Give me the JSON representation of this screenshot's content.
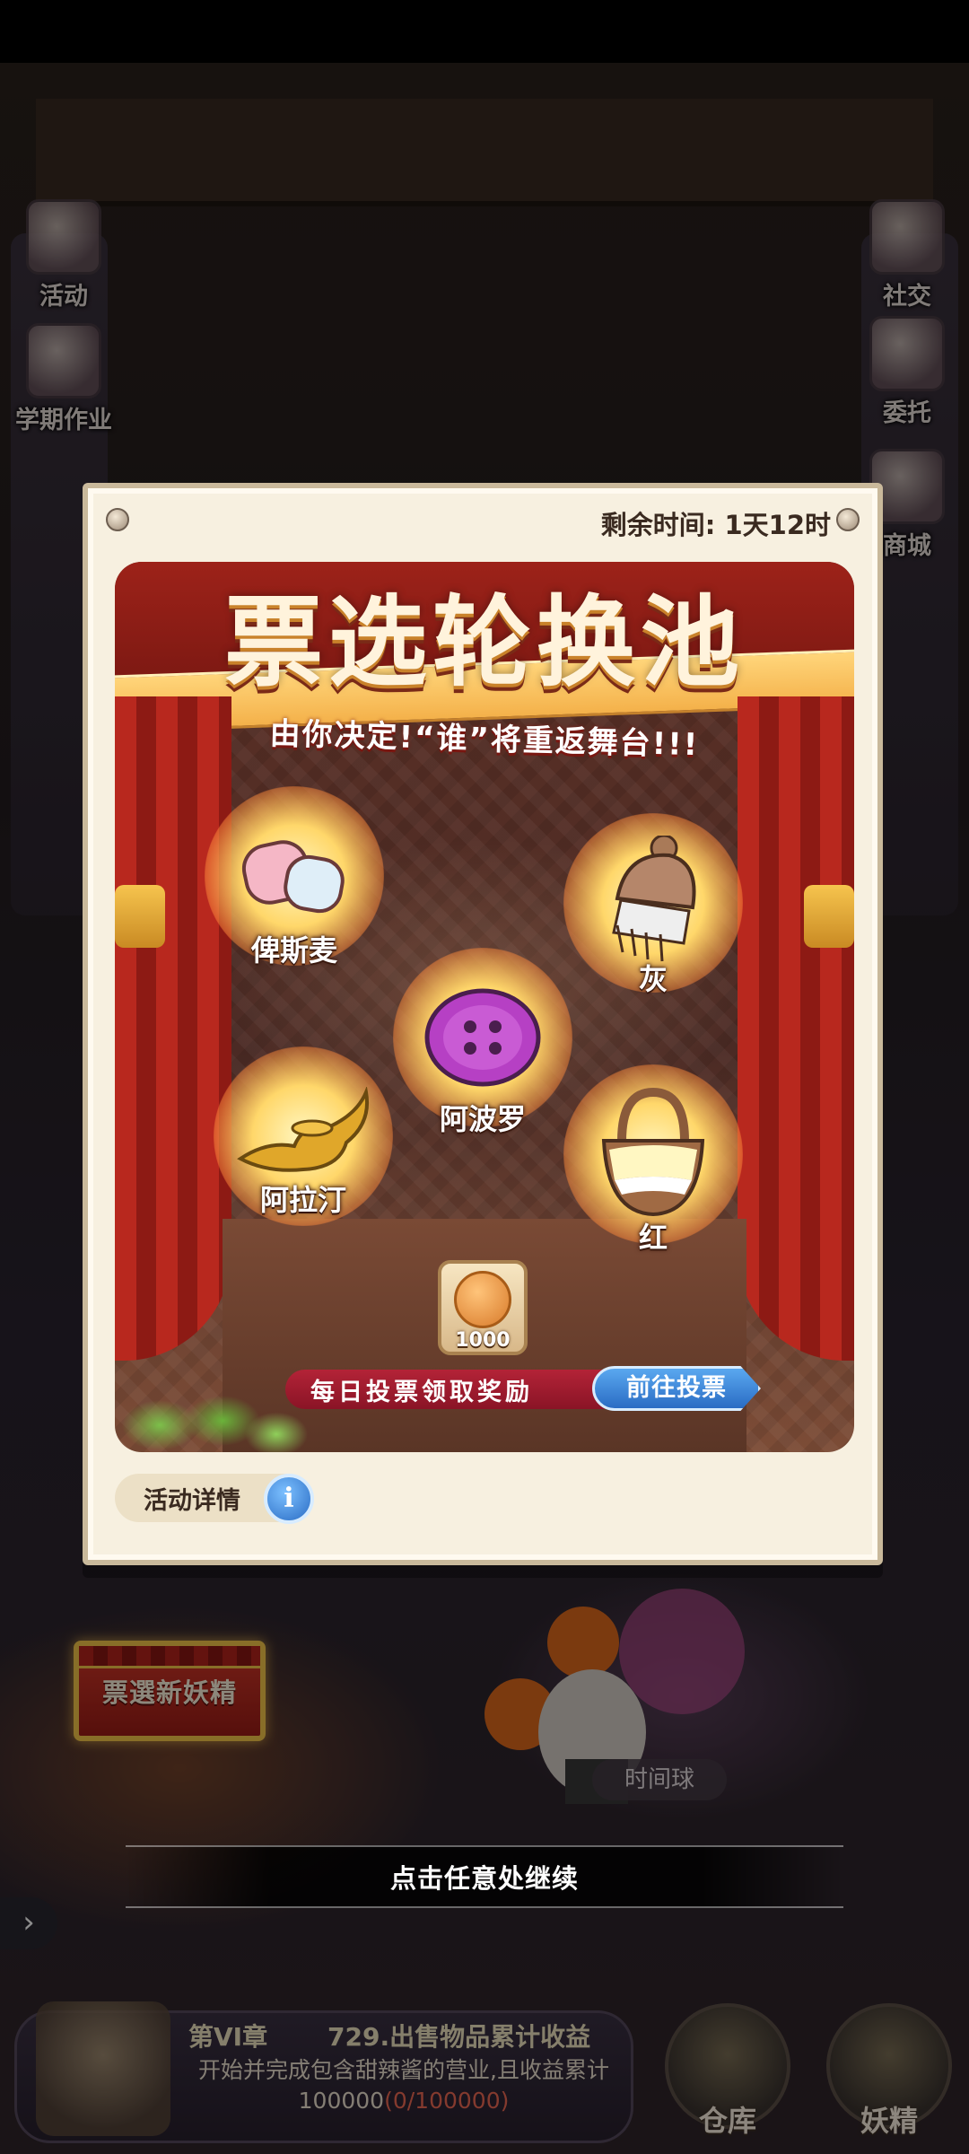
{
  "side_left": [
    {
      "label": "活动",
      "icon": "activity-icon"
    },
    {
      "label": "学期作业",
      "icon": "homework-scroll-icon"
    }
  ],
  "side_right": [
    {
      "label": "社交",
      "icon": "social-icon"
    },
    {
      "label": "委托",
      "icon": "commission-icon"
    },
    {
      "label": "商城",
      "icon": "shop-icon"
    }
  ],
  "modal": {
    "timer": "剩余时间: 1天12时",
    "title": "票选轮换池",
    "subtitle": "由你决定!“谁”将重返舞台!!!",
    "candidates": [
      {
        "name": "俾斯麦",
        "icon": "marshmallow-icon"
      },
      {
        "name": "灰",
        "icon": "knit-hat-comb-icon"
      },
      {
        "name": "阿波罗",
        "icon": "purple-button-icon"
      },
      {
        "name": "阿拉汀",
        "icon": "magic-lamp-icon"
      },
      {
        "name": "红",
        "icon": "basket-icon"
      }
    ],
    "cost": "1000",
    "daily_reward_text": "每日投票领取奖励",
    "goto_vote_label": "前往投票",
    "details_label": "活动详情",
    "info_glyph": "i"
  },
  "vote_button_label": "票選新妖精",
  "time_ball_label": "时间球",
  "continue_text": "点击任意处继续",
  "task": {
    "chapter": "第VI章",
    "title": "729.出售物品累计收益",
    "description": "开始并完成包含甜辣酱的营业,且收益累计100000",
    "progress": "(0/100000)"
  },
  "bottom_buttons": [
    {
      "label": "仓库",
      "icon": "warehouse-chest-icon"
    },
    {
      "label": "妖精",
      "icon": "fairy-icon"
    }
  ],
  "colors": {
    "accent_red": "#b8281e",
    "banner_gold": "#f4b14a",
    "vote_blue": "#2a6cc4"
  }
}
